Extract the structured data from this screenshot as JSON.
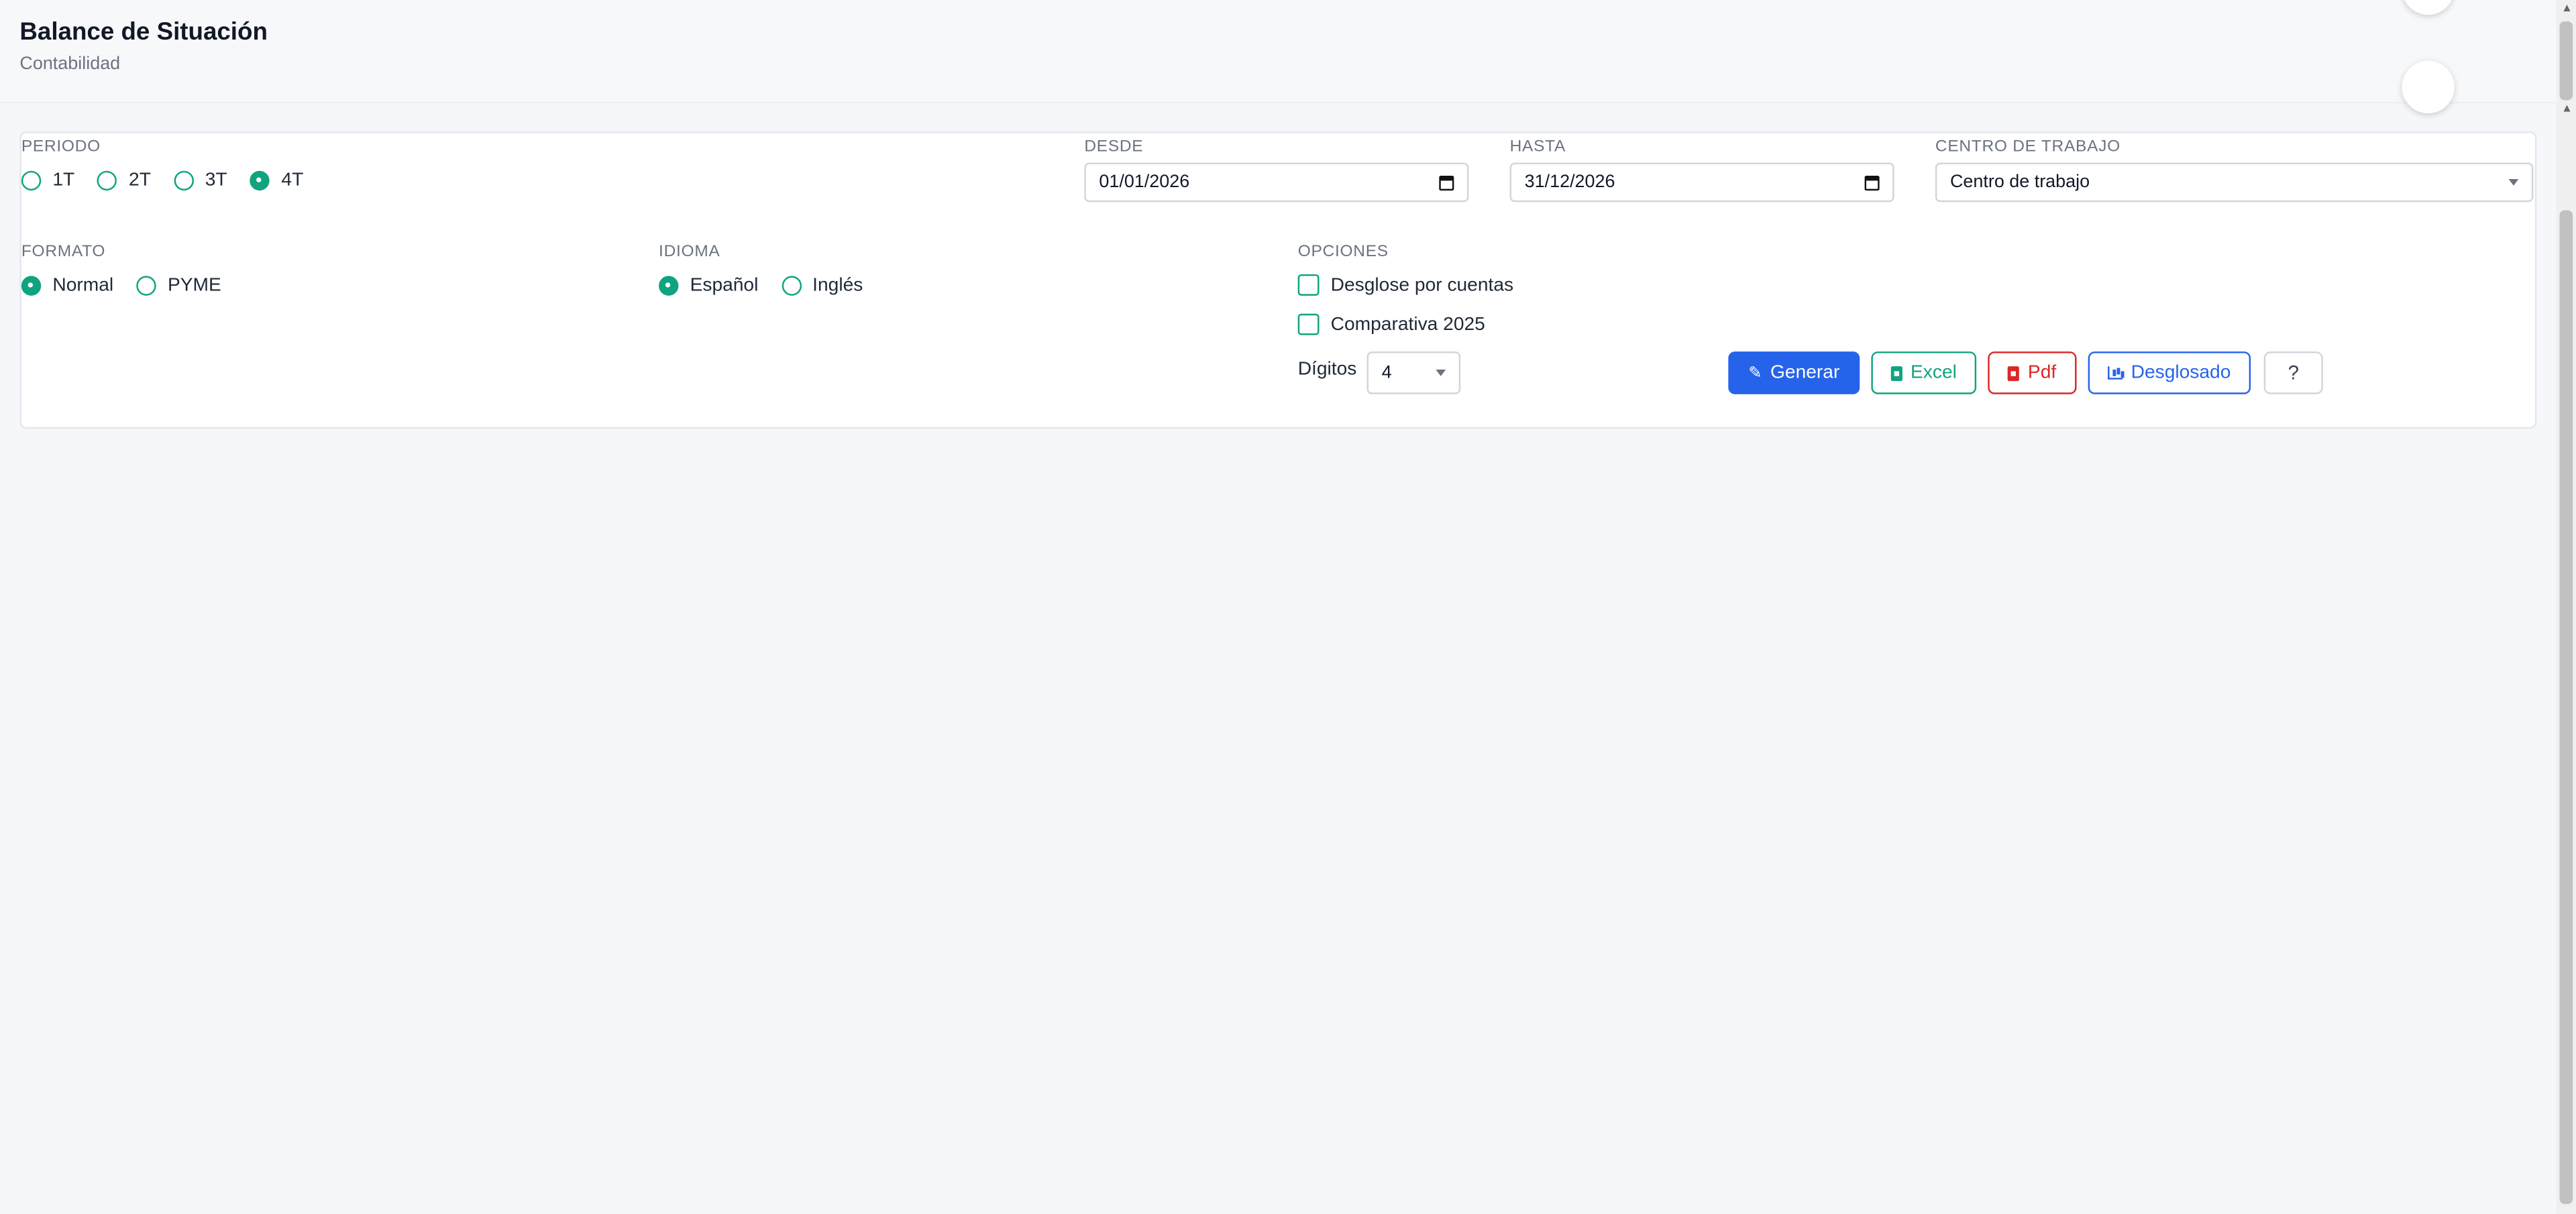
{
  "header": {
    "title": "Balance de Situación",
    "subtitle": "Contabilidad"
  },
  "periodo": {
    "label": "PERIODO",
    "options": [
      "1T",
      "2T",
      "3T",
      "4T"
    ],
    "selected": "4T"
  },
  "desde": {
    "label": "DESDE",
    "value": "01/01/2026"
  },
  "hasta": {
    "label": "HASTA",
    "value": "31/12/2026"
  },
  "centro": {
    "label": "CENTRO DE TRABAJO",
    "value": "Centro de trabajo"
  },
  "formato": {
    "label": "FORMATO",
    "options": [
      "Normal",
      "PYME"
    ],
    "selected": "Normal"
  },
  "idioma": {
    "label": "IDIOMA",
    "options": [
      "Español",
      "Inglés"
    ],
    "selected": "Español"
  },
  "opciones": {
    "label": "OPCIONES",
    "desglose": "Desglose por cuentas",
    "comparativa": "Comparativa 2025"
  },
  "digitos": {
    "label": "Dígitos",
    "value": "4"
  },
  "buttons": {
    "generar": "Generar",
    "excel": "Excel",
    "pdf": "Pdf",
    "desglosado": "Desglosado",
    "help": "?"
  },
  "colors": {
    "accent_green": "#10a37f",
    "primary_blue": "#2563eb",
    "danger_red": "#dc2626"
  }
}
